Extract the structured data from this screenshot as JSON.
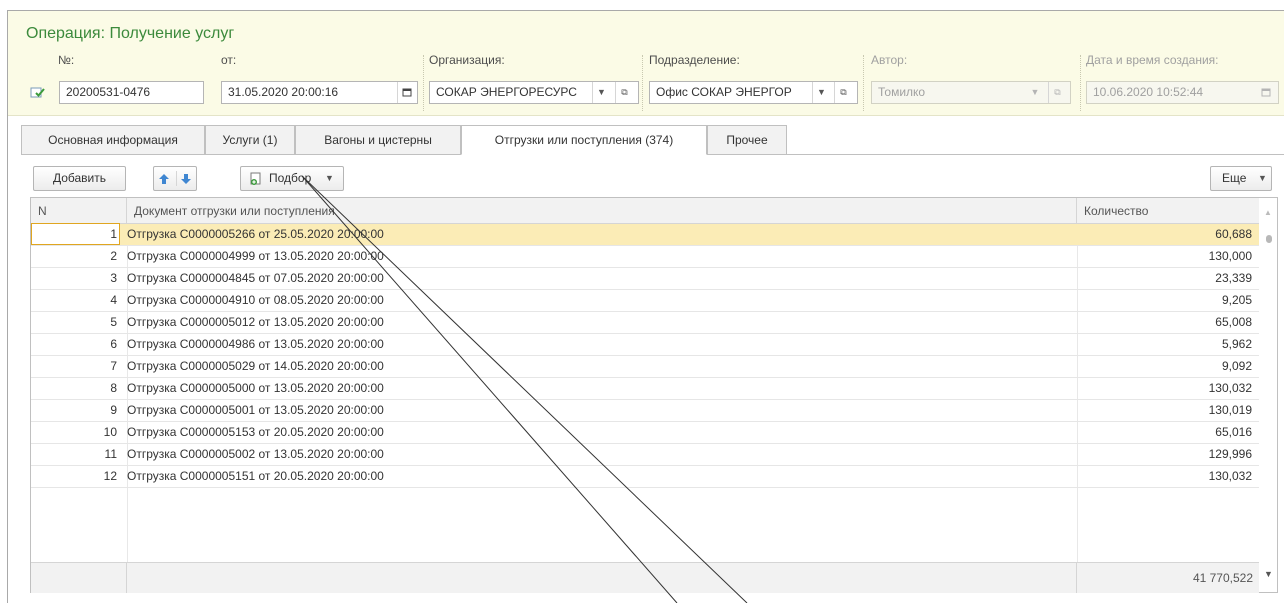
{
  "header": {
    "title": "Операция: Получение услуг",
    "fields": {
      "number": {
        "label": "№:",
        "value": "20200531-0476"
      },
      "date": {
        "label": "от:",
        "value": "31.05.2020 20:00:16"
      },
      "organization": {
        "label": "Организация:",
        "value": "СОКАР ЭНЕРГОРЕСУРС"
      },
      "department": {
        "label": "Подразделение:",
        "value": "Офис СОКАР ЭНЕРГОР"
      },
      "author": {
        "label": "Автор:",
        "value": "Томилко"
      },
      "created": {
        "label": "Дата и время создания:",
        "value": "10.06.2020 10:52:44"
      }
    }
  },
  "tabs": [
    {
      "label": "Основная информация"
    },
    {
      "label": "Услуги (1)"
    },
    {
      "label": "Вагоны и цистерны"
    },
    {
      "label": "Отгрузки или поступления (374)",
      "active": true
    },
    {
      "label": "Прочее"
    }
  ],
  "toolbar": {
    "add_label": "Добавить",
    "pick_label": "Подбор",
    "more_label": "Еще"
  },
  "table": {
    "columns": [
      "N",
      "Документ отгрузки или поступления",
      "Количество"
    ],
    "rows": [
      {
        "n": "1",
        "doc": "Отгрузка С0000005266 от 25.05.2020 20:00:00",
        "qty": "60,688"
      },
      {
        "n": "2",
        "doc": "Отгрузка С0000004999 от 13.05.2020 20:00:00",
        "qty": "130,000"
      },
      {
        "n": "3",
        "doc": "Отгрузка С0000004845 от 07.05.2020 20:00:00",
        "qty": "23,339"
      },
      {
        "n": "4",
        "doc": "Отгрузка С0000004910 от 08.05.2020 20:00:00",
        "qty": "9,205"
      },
      {
        "n": "5",
        "doc": "Отгрузка С0000005012 от 13.05.2020 20:00:00",
        "qty": "65,008"
      },
      {
        "n": "6",
        "doc": "Отгрузка С0000004986 от 13.05.2020 20:00:00",
        "qty": "5,962"
      },
      {
        "n": "7",
        "doc": "Отгрузка С0000005029 от 14.05.2020 20:00:00",
        "qty": "9,092"
      },
      {
        "n": "8",
        "doc": "Отгрузка С0000005000 от 13.05.2020 20:00:00",
        "qty": "130,032"
      },
      {
        "n": "9",
        "doc": "Отгрузка С0000005001 от 13.05.2020 20:00:00",
        "qty": "130,019"
      },
      {
        "n": "10",
        "doc": "Отгрузка С0000005153 от 20.05.2020 20:00:00",
        "qty": "65,016"
      },
      {
        "n": "11",
        "doc": "Отгрузка С0000005002 от 13.05.2020 20:00:00",
        "qty": "129,996"
      },
      {
        "n": "12",
        "doc": "Отгрузка С0000005151 от 20.05.2020 20:00:00",
        "qty": "130,032"
      }
    ],
    "total": "41 770,522"
  },
  "icons": {
    "document": "document-icon",
    "calendar": "calendar-icon",
    "open": "open-icon",
    "dropdown": "chevron-down-icon",
    "move_up": "arrow-up-icon",
    "move_down": "arrow-down-icon",
    "pick": "pick-icon"
  },
  "colors": {
    "title_green": "#3c8a3c",
    "header_bg": "#fbfbe6",
    "selected_row": "#fbecb6",
    "selected_border": "#e0a620",
    "arrow_blue": "#3f86d1"
  }
}
